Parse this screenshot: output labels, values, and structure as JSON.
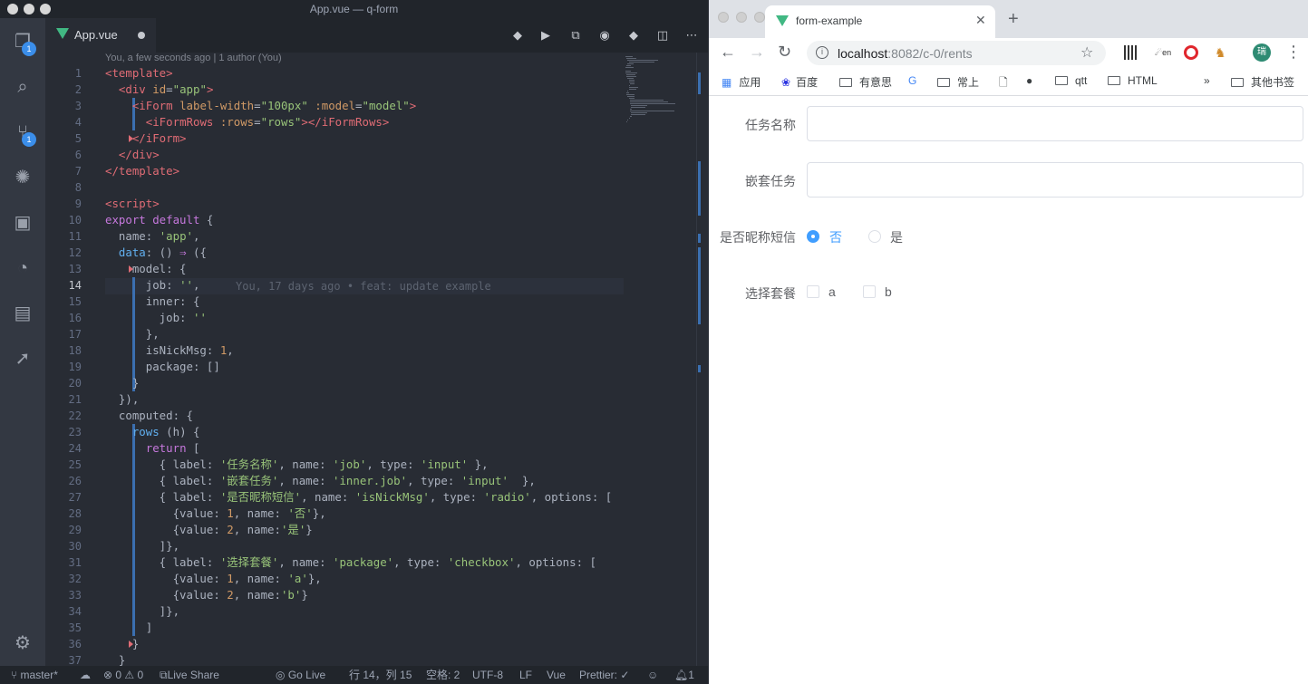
{
  "vscode": {
    "window_title": "App.vue — q-form",
    "tab_label": "App.vue",
    "blame_header": "You, a few seconds ago | 1 author (You)",
    "inline_blame": "You, 17 days ago • feat: update example",
    "explorer_badge": "1",
    "scm_badge": "1",
    "current_line": "14",
    "line_numbers": [
      "1",
      "2",
      "3",
      "4",
      "5",
      "6",
      "7",
      "8",
      "9",
      "10",
      "11",
      "12",
      "13",
      "14",
      "15",
      "16",
      "17",
      "18",
      "19",
      "20",
      "21",
      "22",
      "23",
      "24",
      "25",
      "26",
      "27",
      "28",
      "29",
      "30",
      "31",
      "32",
      "33",
      "34",
      "35",
      "36",
      "37"
    ],
    "code_lines": [
      [
        [
          "tg",
          "<template>"
        ]
      ],
      [
        [
          "p",
          "  "
        ],
        [
          "tg",
          "<div "
        ],
        [
          "at",
          "id"
        ],
        [
          "p",
          "="
        ],
        [
          "s",
          "\"app\""
        ],
        [
          "tg",
          ">"
        ]
      ],
      [
        [
          "p",
          "    "
        ],
        [
          "tg",
          "<iForm "
        ],
        [
          "at",
          "label-width"
        ],
        [
          "p",
          "="
        ],
        [
          "s",
          "\"100px\""
        ],
        [
          "p",
          " "
        ],
        [
          "at",
          ":model"
        ],
        [
          "p",
          "="
        ],
        [
          "s",
          "\"model\""
        ],
        [
          "tg",
          ">"
        ]
      ],
      [
        [
          "p",
          "      "
        ],
        [
          "tg",
          "<iFormRows "
        ],
        [
          "at",
          ":rows"
        ],
        [
          "p",
          "="
        ],
        [
          "s",
          "\"rows\""
        ],
        [
          "tg",
          "></iFormRows>"
        ]
      ],
      [
        [
          "p",
          "    "
        ],
        [
          "tg",
          "</iForm>"
        ]
      ],
      [
        [
          "p",
          "  "
        ],
        [
          "tg",
          "</div>"
        ]
      ],
      [
        [
          "tg",
          "</template>"
        ]
      ],
      [
        [
          "p",
          ""
        ]
      ],
      [
        [
          "tg",
          "<script>"
        ]
      ],
      [
        [
          "k",
          "export default "
        ],
        [
          "p",
          "{"
        ]
      ],
      [
        [
          "p",
          "  name: "
        ],
        [
          "s",
          "'app'"
        ],
        [
          "p",
          ","
        ]
      ],
      [
        [
          "p",
          "  "
        ],
        [
          "f",
          "data"
        ],
        [
          "p",
          ": () "
        ],
        [
          "k",
          "⇒"
        ],
        [
          "p",
          " ({"
        ]
      ],
      [
        [
          "p",
          "    model: {"
        ]
      ],
      [
        [
          "p",
          "      job: "
        ],
        [
          "s",
          "''"
        ],
        [
          "p",
          ","
        ]
      ],
      [
        [
          "p",
          "      inner: {"
        ]
      ],
      [
        [
          "p",
          "        job: "
        ],
        [
          "s",
          "''"
        ]
      ],
      [
        [
          "p",
          "      },"
        ]
      ],
      [
        [
          "p",
          "      isNickMsg: "
        ],
        [
          "n",
          "1"
        ],
        [
          "p",
          ","
        ]
      ],
      [
        [
          "p",
          "      package: []"
        ]
      ],
      [
        [
          "p",
          "    }"
        ]
      ],
      [
        [
          "p",
          "  }),"
        ]
      ],
      [
        [
          "p",
          "  computed: {"
        ]
      ],
      [
        [
          "p",
          "    "
        ],
        [
          "f",
          "rows"
        ],
        [
          "p",
          " (h) {"
        ]
      ],
      [
        [
          "p",
          "      "
        ],
        [
          "k",
          "return"
        ],
        [
          "p",
          " ["
        ]
      ],
      [
        [
          "p",
          "        { label: "
        ],
        [
          "s",
          "'任务名称'"
        ],
        [
          "p",
          ", name: "
        ],
        [
          "s",
          "'job'"
        ],
        [
          "p",
          ", type: "
        ],
        [
          "s",
          "'input'"
        ],
        [
          "p",
          " },"
        ]
      ],
      [
        [
          "p",
          "        { label: "
        ],
        [
          "s",
          "'嵌套任务'"
        ],
        [
          "p",
          ", name: "
        ],
        [
          "s",
          "'inner.job'"
        ],
        [
          "p",
          ", type: "
        ],
        [
          "s",
          "'input'"
        ],
        [
          "p",
          "  },"
        ]
      ],
      [
        [
          "p",
          "        { label: "
        ],
        [
          "s",
          "'是否昵称短信'"
        ],
        [
          "p",
          ", name: "
        ],
        [
          "s",
          "'isNickMsg'"
        ],
        [
          "p",
          ", type: "
        ],
        [
          "s",
          "'radio'"
        ],
        [
          "p",
          ", options: ["
        ]
      ],
      [
        [
          "p",
          "          {value: "
        ],
        [
          "n",
          "1"
        ],
        [
          "p",
          ", name: "
        ],
        [
          "s",
          "'否'"
        ],
        [
          "p",
          "},"
        ]
      ],
      [
        [
          "p",
          "          {value: "
        ],
        [
          "n",
          "2"
        ],
        [
          "p",
          ", name:"
        ],
        [
          "s",
          "'是'"
        ],
        [
          "p",
          "}"
        ]
      ],
      [
        [
          "p",
          "        ]},"
        ]
      ],
      [
        [
          "p",
          "        { label: "
        ],
        [
          "s",
          "'选择套餐'"
        ],
        [
          "p",
          ", name: "
        ],
        [
          "s",
          "'package'"
        ],
        [
          "p",
          ", type: "
        ],
        [
          "s",
          "'checkbox'"
        ],
        [
          "p",
          ", options: ["
        ]
      ],
      [
        [
          "p",
          "          {value: "
        ],
        [
          "n",
          "1"
        ],
        [
          "p",
          ", name: "
        ],
        [
          "s",
          "'a'"
        ],
        [
          "p",
          "},"
        ]
      ],
      [
        [
          "p",
          "          {value: "
        ],
        [
          "n",
          "2"
        ],
        [
          "p",
          ", name:"
        ],
        [
          "s",
          "'b'"
        ],
        [
          "p",
          "}"
        ]
      ],
      [
        [
          "p",
          "        ]},"
        ]
      ],
      [
        [
          "p",
          "      ]"
        ]
      ],
      [
        [
          "p",
          "    }"
        ]
      ],
      [
        [
          "p",
          "  }"
        ]
      ]
    ],
    "status": {
      "branch": "master*",
      "errors": "0",
      "warnings": "0",
      "live_share": "Live Share",
      "go_live": "Go Live",
      "position": "行 14，列 15",
      "spaces": "空格: 2",
      "encoding": "UTF-8",
      "eol": "LF",
      "language": "Vue",
      "prettier": "Prettier: ✓",
      "bell": "1"
    }
  },
  "chrome": {
    "tab_title": "form-example",
    "url_host": "localhost",
    "url_rest": ":8082/c-0/rents",
    "profile_initial": "瑞",
    "bookmarks": [
      "应用",
      "百度",
      "有意思",
      "常上",
      "qtt",
      "HTML"
    ],
    "other_bookmarks": "其他书签",
    "form": {
      "job_label": "任务名称",
      "inner_label": "嵌套任务",
      "radio_label": "是否昵称短信",
      "radio_options": [
        "否",
        "是"
      ],
      "radio_selected": "否",
      "checkbox_label": "选择套餐",
      "checkbox_options": [
        "a",
        "b"
      ]
    }
  }
}
